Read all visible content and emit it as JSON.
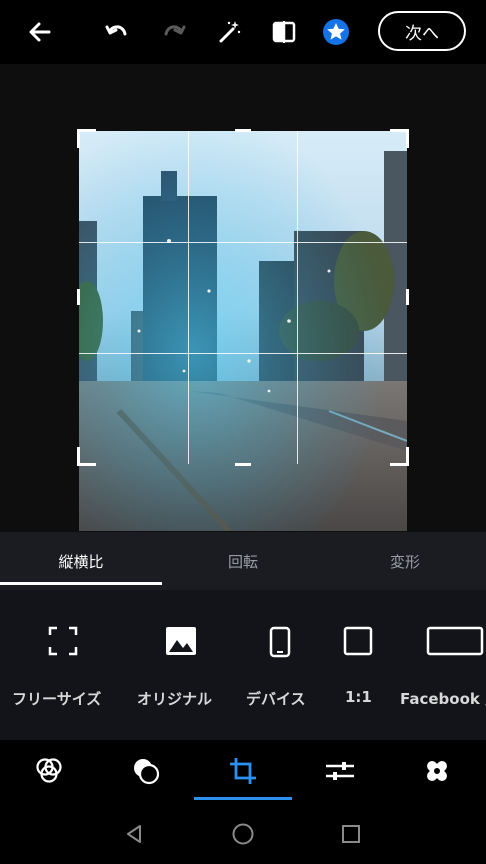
{
  "top_bar": {
    "next_label": "次へ",
    "icons": [
      "back-arrow-icon",
      "undo-icon",
      "redo-icon",
      "magic-wand-icon",
      "compare-icon",
      "star-badge-icon"
    ],
    "accent": "#1473e6"
  },
  "tabs": [
    {
      "label": "縦横比",
      "active": true
    },
    {
      "label": "回転",
      "active": false
    },
    {
      "label": "変形",
      "active": false
    }
  ],
  "aspect_options": [
    {
      "label": "フリーサイズ",
      "icon": "free-size-icon"
    },
    {
      "label": "オリジナル",
      "icon": "image-icon"
    },
    {
      "label": "デバイス",
      "icon": "phone-icon"
    },
    {
      "label": "1:1",
      "icon": "square-icon"
    },
    {
      "label": "Facebook 広",
      "icon": "wide-rectangle-icon"
    }
  ],
  "bottom_tools": [
    {
      "icon": "looks-icon",
      "active": false
    },
    {
      "icon": "overlay-icon",
      "active": false
    },
    {
      "icon": "crop-icon",
      "active": true
    },
    {
      "icon": "adjust-sliders-icon",
      "active": false
    },
    {
      "icon": "healing-bandage-icon",
      "active": false
    }
  ],
  "active_color": "#2b90f0",
  "system_nav": [
    "back-triangle-icon",
    "home-circle-icon",
    "recents-square-icon"
  ]
}
